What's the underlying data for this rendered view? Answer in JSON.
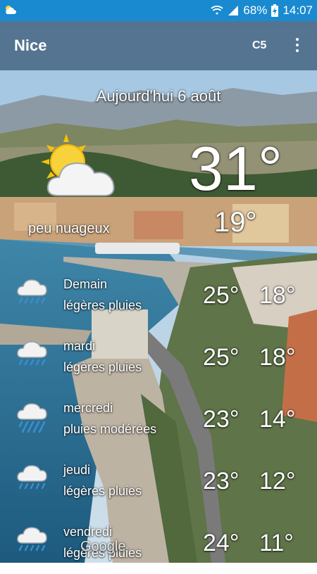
{
  "status_bar": {
    "battery": "68%",
    "time": "14:07"
  },
  "app_bar": {
    "city": "Nice",
    "unit_button": "C5",
    "menu_icon": "more-vert-icon"
  },
  "today": {
    "label": "Aujourd'hui 6 août",
    "temp_max": "31°",
    "temp_min": "19°",
    "condition": "peu nuageux",
    "icon": "partly-cloudy-icon"
  },
  "forecast": [
    {
      "day": "Demain",
      "condition": "légères pluies",
      "max": "25°",
      "min": "18°",
      "icon": "light-rain-icon"
    },
    {
      "day": "mardi",
      "condition": "légères pluies",
      "max": "25°",
      "min": "18°",
      "icon": "light-rain-icon"
    },
    {
      "day": "mercredi",
      "condition": "pluies modérées",
      "max": "23°",
      "min": "14°",
      "icon": "moderate-rain-icon"
    },
    {
      "day": "jeudi",
      "condition": "légères pluies",
      "max": "23°",
      "min": "12°",
      "icon": "light-rain-icon"
    },
    {
      "day": "vendredi",
      "condition": "légères pluies",
      "max": "24°",
      "min": "11°",
      "icon": "light-rain-icon"
    }
  ],
  "attribution": "Google",
  "colors": {
    "status_bar": "#1a8ad0",
    "app_bar_overlay": "#14324f",
    "rain_drops": "#3a8fd0"
  }
}
